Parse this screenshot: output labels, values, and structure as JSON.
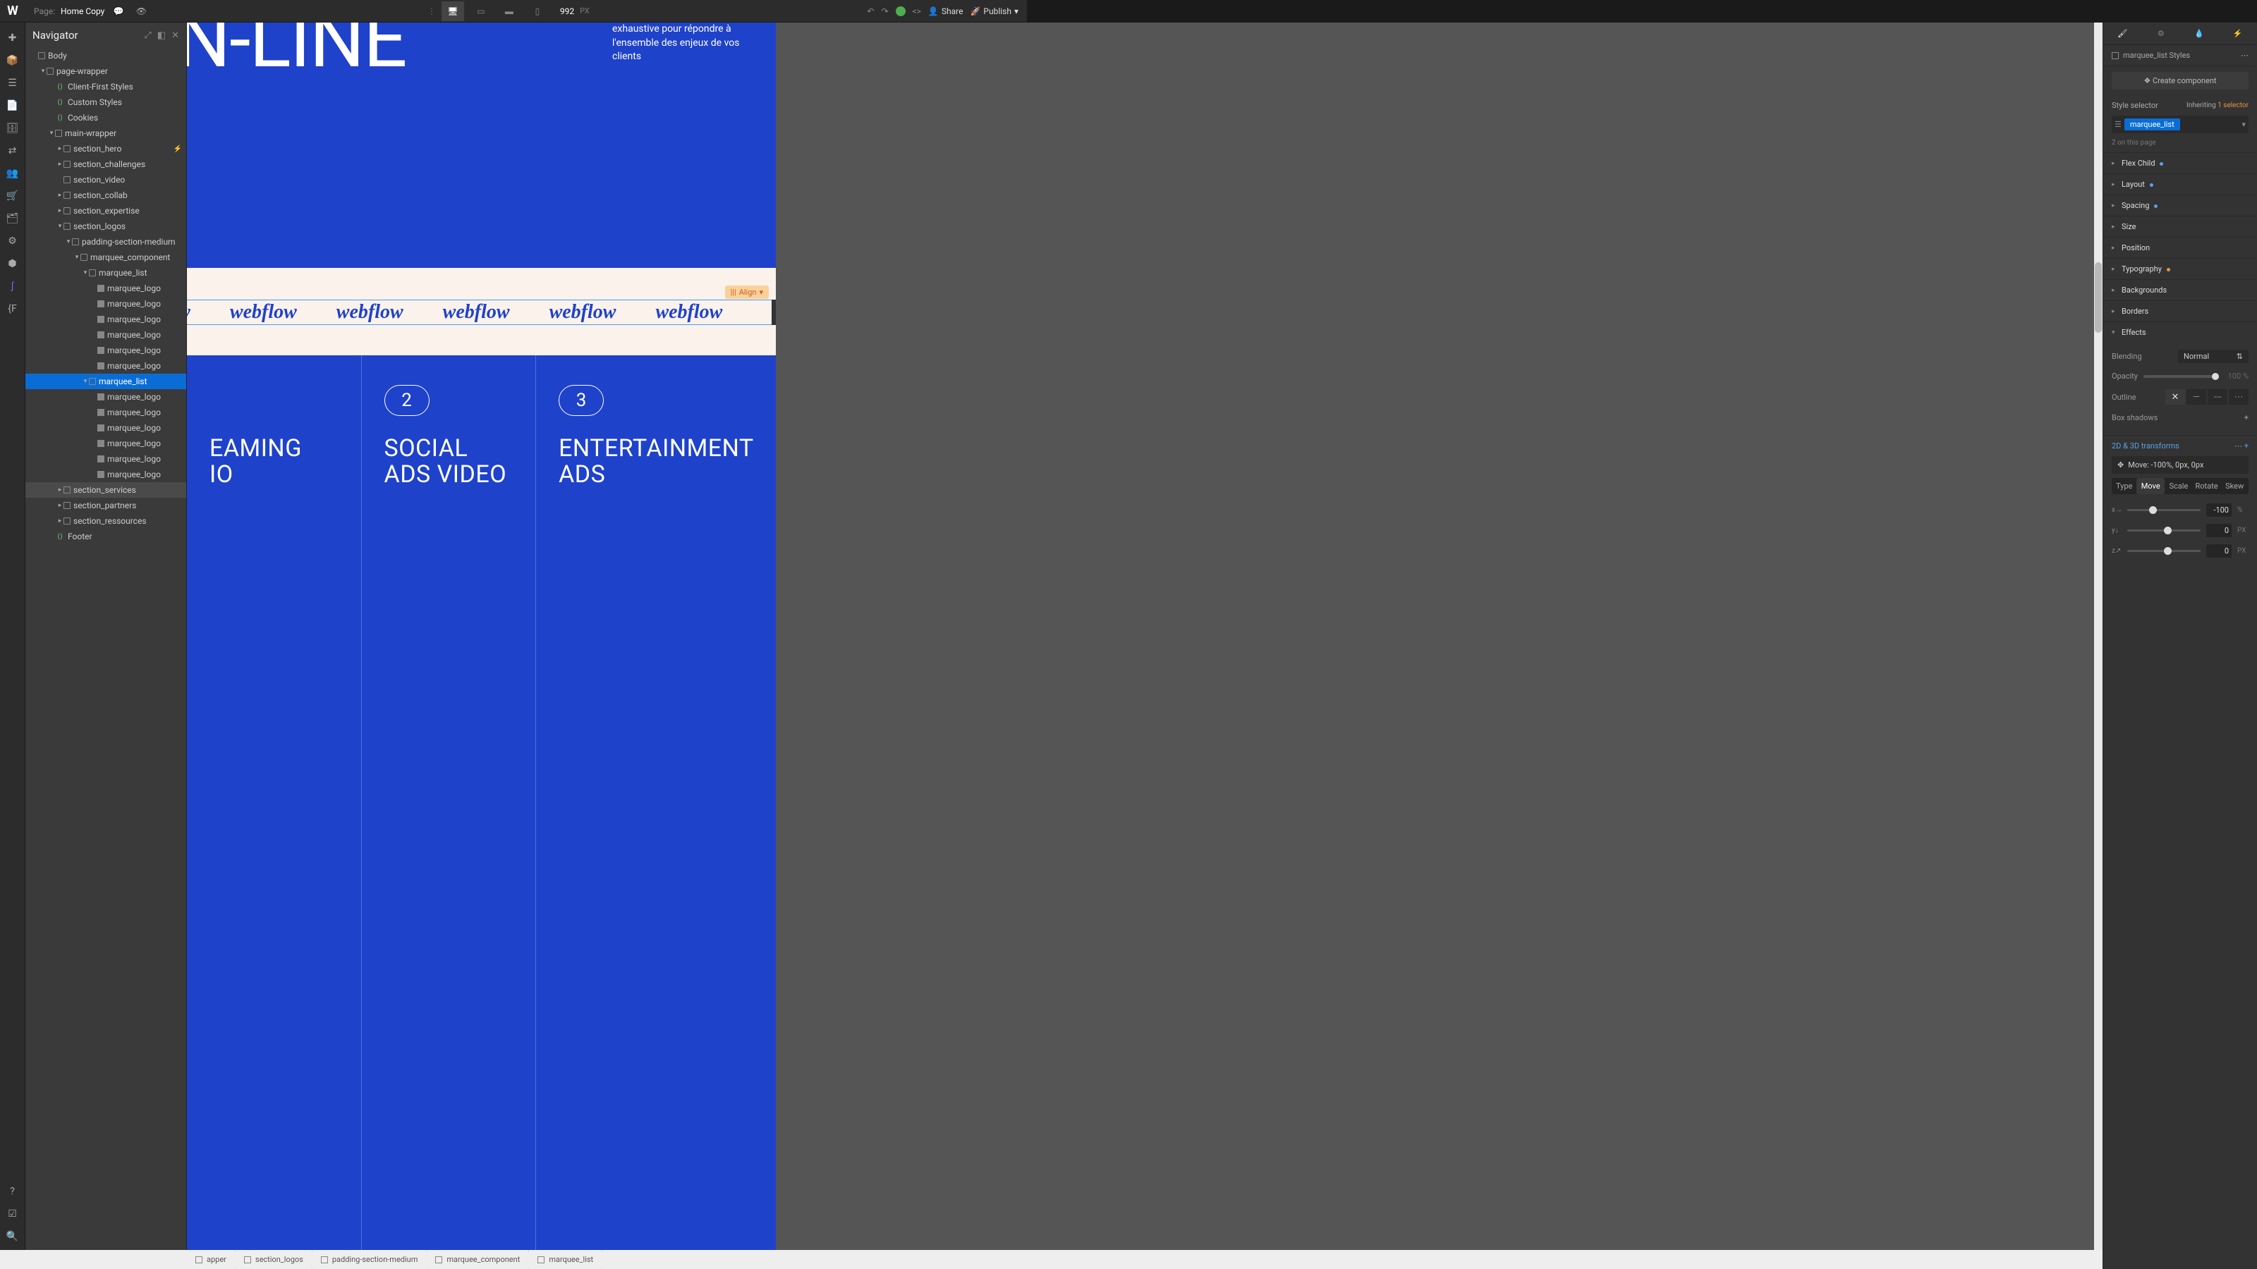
{
  "topbar": {
    "page_label": "Page:",
    "page_name": "Home Copy",
    "viewport": "992",
    "viewport_unit": "PX",
    "share": "Share",
    "publish": "Publish"
  },
  "navigator": {
    "title": "Navigator",
    "tree": [
      {
        "indent": 0,
        "caret": "",
        "icon": "div",
        "label": "Body"
      },
      {
        "indent": 1,
        "caret": "▾",
        "icon": "div",
        "label": "page-wrapper"
      },
      {
        "indent": 2,
        "caret": "",
        "icon": "embed",
        "label": "Client-First Styles"
      },
      {
        "indent": 2,
        "caret": "",
        "icon": "embed",
        "label": "Custom Styles"
      },
      {
        "indent": 2,
        "caret": "",
        "icon": "embed",
        "label": "Cookies"
      },
      {
        "indent": 2,
        "caret": "▾",
        "icon": "div",
        "label": "main-wrapper"
      },
      {
        "indent": 3,
        "caret": "▸",
        "icon": "div",
        "label": "section_hero",
        "bolt": true
      },
      {
        "indent": 3,
        "caret": "▸",
        "icon": "div",
        "label": "section_challenges"
      },
      {
        "indent": 3,
        "caret": "",
        "icon": "div",
        "label": "section_video"
      },
      {
        "indent": 3,
        "caret": "▸",
        "icon": "div",
        "label": "section_collab"
      },
      {
        "indent": 3,
        "caret": "▸",
        "icon": "div",
        "label": "section_expertise"
      },
      {
        "indent": 3,
        "caret": "▾",
        "icon": "div",
        "label": "section_logos"
      },
      {
        "indent": 4,
        "caret": "▾",
        "icon": "div",
        "label": "padding-section-medium"
      },
      {
        "indent": 5,
        "caret": "▾",
        "icon": "div",
        "label": "marquee_component"
      },
      {
        "indent": 6,
        "caret": "▾",
        "icon": "div",
        "label": "marquee_list"
      },
      {
        "indent": 7,
        "caret": "",
        "icon": "img",
        "label": "marquee_logo"
      },
      {
        "indent": 7,
        "caret": "",
        "icon": "img",
        "label": "marquee_logo"
      },
      {
        "indent": 7,
        "caret": "",
        "icon": "img",
        "label": "marquee_logo"
      },
      {
        "indent": 7,
        "caret": "",
        "icon": "img",
        "label": "marquee_logo"
      },
      {
        "indent": 7,
        "caret": "",
        "icon": "img",
        "label": "marquee_logo"
      },
      {
        "indent": 7,
        "caret": "",
        "icon": "img",
        "label": "marquee_logo"
      },
      {
        "indent": 6,
        "caret": "▾",
        "icon": "div",
        "label": "marquee_list",
        "selected": true
      },
      {
        "indent": 7,
        "caret": "",
        "icon": "img",
        "label": "marquee_logo"
      },
      {
        "indent": 7,
        "caret": "",
        "icon": "img",
        "label": "marquee_logo"
      },
      {
        "indent": 7,
        "caret": "",
        "icon": "img",
        "label": "marquee_logo"
      },
      {
        "indent": 7,
        "caret": "",
        "icon": "img",
        "label": "marquee_logo"
      },
      {
        "indent": 7,
        "caret": "",
        "icon": "img",
        "label": "marquee_logo"
      },
      {
        "indent": 7,
        "caret": "",
        "icon": "img",
        "label": "marquee_logo"
      },
      {
        "indent": 3,
        "caret": "▸",
        "icon": "div",
        "label": "section_services",
        "hovered": true
      },
      {
        "indent": 3,
        "caret": "▸",
        "icon": "div",
        "label": "section_partners"
      },
      {
        "indent": 3,
        "caret": "▸",
        "icon": "div",
        "label": "section_ressources"
      },
      {
        "indent": 2,
        "caret": "",
        "icon": "embed",
        "label": "Footer"
      }
    ]
  },
  "canvas": {
    "hero_headline": "ON-LINE",
    "hero_para": "exhaustive pour répondre à l'ensemble des enjeux de vos clients",
    "marquee_text": "webflow",
    "align_label": "Align",
    "cards": [
      {
        "num": "",
        "title": "EAMING\nIO"
      },
      {
        "num": "2",
        "title": "SOCIAL ADS VIDEO"
      },
      {
        "num": "3",
        "title": "ENTERTAINMENT ADS"
      }
    ]
  },
  "breadcrumb": [
    "apper",
    "section_logos",
    "padding-section-medium",
    "marquee_component",
    "marquee_list"
  ],
  "right_panel": {
    "styles_label": "marquee_list Styles",
    "create_component": "Create component",
    "style_selector": "Style selector",
    "inheriting": "Inheriting",
    "inherit_count": "1 selector",
    "selector_tag": "marquee_list",
    "on_page": "2 on this page",
    "accordions": [
      {
        "label": "Flex Child",
        "caret": "▸",
        "dot": "blue"
      },
      {
        "label": "Layout",
        "caret": "▸",
        "dot": "blue"
      },
      {
        "label": "Spacing",
        "caret": "▸",
        "dot": "blue"
      },
      {
        "label": "Size",
        "caret": "▸"
      },
      {
        "label": "Position",
        "caret": "▸"
      },
      {
        "label": "Typography",
        "caret": "▸",
        "dot": "orange"
      },
      {
        "label": "Backgrounds",
        "caret": "▸"
      },
      {
        "label": "Borders",
        "caret": "▸"
      },
      {
        "label": "Effects",
        "caret": "▾",
        "open": true
      }
    ],
    "effects": {
      "blending_label": "Blending",
      "blending_value": "Normal",
      "opacity_label": "Opacity",
      "opacity_value": "100",
      "opacity_unit": "%",
      "outline_label": "Outline",
      "box_shadows": "Box shadows",
      "transforms_header": "2D & 3D transforms",
      "transform_item": "Move: -100%, 0px, 0px",
      "type_label": "Type",
      "type_tabs": [
        "Move",
        "Scale",
        "Rotate",
        "Skew"
      ],
      "sliders": [
        {
          "axis": "x→",
          "value": "-100",
          "unit": "%",
          "pos": 30
        },
        {
          "axis": "y↓",
          "value": "0",
          "unit": "PX",
          "pos": 50
        },
        {
          "axis": "z↗",
          "value": "0",
          "unit": "PX",
          "pos": 50
        }
      ]
    }
  }
}
